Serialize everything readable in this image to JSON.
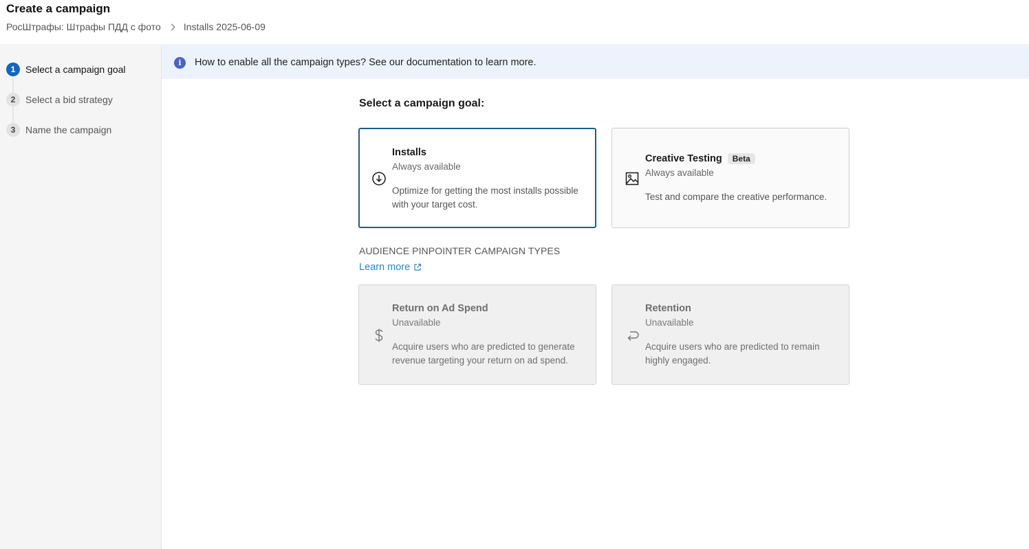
{
  "header": {
    "title": "Create a campaign",
    "breadcrumb": [
      "РосШтрафы: Штрафы ПДД с фото",
      "Installs 2025-06-09"
    ]
  },
  "steps": [
    {
      "num": "1",
      "label": "Select a campaign goal",
      "active": true
    },
    {
      "num": "2",
      "label": "Select a bid strategy",
      "active": false
    },
    {
      "num": "3",
      "label": "Name the campaign",
      "active": false
    }
  ],
  "banner": {
    "icon": "info-icon",
    "text": "How to enable all the campaign types? See our documentation to learn more."
  },
  "main": {
    "section_title": "Select a campaign goal:",
    "cards": [
      {
        "title": "Installs",
        "status": "Always available",
        "desc": "Optimize for getting the most installs possible with your target cost.",
        "icon": "download-circle-icon",
        "selected": true
      },
      {
        "title": "Creative Testing",
        "badge": "Beta",
        "status": "Always available",
        "desc": "Test and compare the creative performance.",
        "icon": "image-icon"
      }
    ],
    "group_title": "AUDIENCE PINPOINTER CAMPAIGN TYPES",
    "learn_more": "Learn more",
    "disabled_cards": [
      {
        "title": "Return on Ad Spend",
        "status": "Unavailable",
        "desc": "Acquire users who are predicted to generate revenue targeting your return on ad spend.",
        "icon": "dollar-icon"
      },
      {
        "title": "Retention",
        "status": "Unavailable",
        "desc": "Acquire users who are predicted to remain highly engaged.",
        "icon": "return-arrow-icon"
      }
    ]
  },
  "colors": {
    "accent": "#1565c0",
    "selected_border": "#1a5e8f",
    "link": "#2a86c9",
    "banner_bg": "#edf3fd"
  }
}
